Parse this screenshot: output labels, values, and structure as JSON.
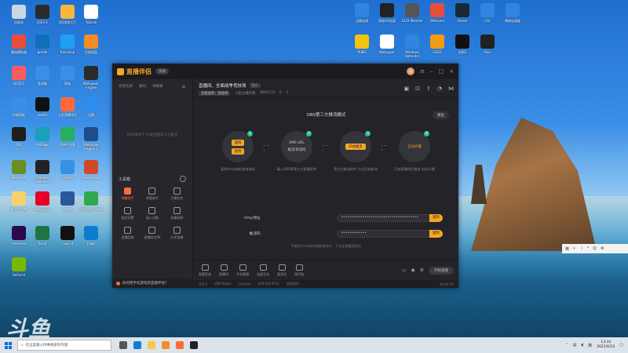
{
  "wallpaper_watermark": "斗鱼",
  "desktop_icons": [
    {
      "label": "回收站",
      "color": "#c9d6e3"
    },
    {
      "label": "2024-1",
      "color": "#2b2b2b"
    },
    {
      "label": "QQ游戏大厅",
      "color": "#f6b73c"
    },
    {
      "label": "ToDesk",
      "color": "#ffffff"
    },
    {
      "label": "雷电模拟器",
      "color": "#e74c3c"
    },
    {
      "label": "gradle",
      "color": "#0f6fb8"
    },
    {
      "label": "RainDrop",
      "color": "#1ea1f2"
    },
    {
      "label": "百度网盘",
      "color": "#f28c28"
    },
    {
      "label": "QQ音乐",
      "color": "#ff5a5f"
    },
    {
      "label": "此电脑",
      "color": "#3a8ee6"
    },
    {
      "label": "网络",
      "color": "#3a8ee6"
    },
    {
      "label": "Wallpaper Engine",
      "color": "#2a2a2a"
    },
    {
      "label": "控制面板",
      "color": "#3a8ee6"
    },
    {
      "label": "obs64",
      "color": "#111111"
    },
    {
      "label": "斗鱼直播伴侣",
      "color": "#ff6a3d"
    },
    {
      "label": "迅雷",
      "color": "#2d8cf0"
    },
    {
      "label": "QQ",
      "color": "#1e1e1e"
    },
    {
      "label": "ArtRage",
      "color": "#1aa0b8"
    },
    {
      "label": "剪映专业版",
      "color": "#27ae60"
    },
    {
      "label": "Wallpaper Engine 2",
      "color": "#1e4d8c"
    },
    {
      "label": "Minecraft",
      "color": "#6b8e23"
    },
    {
      "label": "Onboard Ultimate",
      "color": "#222222"
    },
    {
      "label": "QQ空间",
      "color": "#3a8ee6"
    },
    {
      "label": "PowerPoint",
      "color": "#d24726"
    },
    {
      "label": "新建文件夹",
      "color": "#f7d26a"
    },
    {
      "label": "网易云音乐",
      "color": "#e60026"
    },
    {
      "label": "Word",
      "color": "#2b579a"
    },
    {
      "label": "Microsoft Store",
      "color": "#2fa84f"
    },
    {
      "label": "Premiere",
      "color": "#2a0a4a"
    },
    {
      "label": "Excel",
      "color": "#217346"
    },
    {
      "label": "CapCut",
      "color": "#111111"
    },
    {
      "label": "Edge",
      "color": "#0f7ccf"
    },
    {
      "label": "GeForce",
      "color": "#76b900"
    }
  ],
  "right_icons": [
    {
      "label": "迅雷加速",
      "color": "#2e86de"
    },
    {
      "label": "网易UU加速",
      "color": "#222222"
    },
    {
      "label": "1020 Monster",
      "color": "#555555"
    },
    {
      "label": "WeGame",
      "color": "#e74c3c"
    },
    {
      "label": "Steam",
      "color": "#1b2838"
    },
    {
      "label": "LOL",
      "color": "#2e86de"
    },
    {
      "label": "雷神加速器",
      "color": "#2e86de"
    },
    {
      "label": "PUBG",
      "color": "#f1c40f"
    },
    {
      "label": "Wallpaper",
      "color": "#ffffff"
    },
    {
      "label": "Windows Defender",
      "color": "#2e86de"
    },
    {
      "label": "CSGO",
      "color": "#f39c12"
    },
    {
      "label": "剑网3",
      "color": "#111111"
    },
    {
      "label": "Pixiv",
      "color": "#222222"
    }
  ],
  "app": {
    "logo_text": "直播伴侣",
    "version_badge": "旗舰",
    "left_tabs": [
      "场景选择",
      "素材",
      "弹幕箱"
    ],
    "left_empty_text": "OBS模式下 仅能直播第三方推流",
    "tools_heading": "工具箱",
    "tools": [
      {
        "label": "弹幕助手",
        "icon": "danmaku-icon",
        "active": true
      },
      {
        "label": "房管助手",
        "icon": "user-icon",
        "active": false
      },
      {
        "label": "主播任务",
        "icon": "task-icon",
        "active": false
      },
      {
        "label": "抽奖设置",
        "icon": "gift-icon",
        "active": false
      },
      {
        "label": "录入设备",
        "icon": "record-icon",
        "active": false
      },
      {
        "label": "屏幕录制",
        "icon": "screen-icon",
        "active": false
      },
      {
        "label": "直播回放",
        "icon": "replay-icon",
        "active": false
      },
      {
        "label": "直播排名PK",
        "icon": "pk-icon",
        "active": false
      },
      {
        "label": "分享直播",
        "icon": "share-icon",
        "active": false
      }
    ],
    "left_footer": "如何把手机游戏到直播伴侣？",
    "room_title": "直播间、全面战争竞技场",
    "room_tag": "官方",
    "room_meta": {
      "category": "全面战争：竞技场",
      "anchor": "斗鱼主播开播",
      "room_id": "8983176",
      "fans": "0",
      "viewers": "1"
    },
    "mode_title": "OBS第三方推流模式",
    "exit_label": "退出",
    "steps": [
      {
        "number": "1",
        "items": [
          "复制",
          "复制"
        ],
        "desc": "复制rtmp地址和推流码",
        "highlight": false
      },
      {
        "number": "2",
        "items": [
          "RMS URL",
          "推流/串流码"
        ],
        "desc": "填入OBS等第三方直播软件",
        "highlight": false
      },
      {
        "number": "3",
        "items": [
          "开始推流"
        ],
        "desc": "第三方推流软件 点击开始推流",
        "highlight": true
      },
      {
        "number": "4",
        "items": [
          "自动开播"
        ],
        "desc": "开启直播伴侣推流 自动开播",
        "highlight": false
      }
    ],
    "rtmp_label": "rtmp地址",
    "rtmp_value": "•••••••••••••••••••••••••••••••••••••",
    "key_label": "推流码",
    "key_value": "••••••••••••",
    "copy_label": "复制",
    "hint": "不能在rtmp地址和推流码中，下方无需截屏保存",
    "toolbar": [
      "直播音效",
      "直播间",
      "手机直播",
      "连麦互动",
      "麦克风",
      "扬声器"
    ],
    "start_live_label": "开始直播",
    "status": {
      "fps": "FPS:0",
      "bitrate": "码率:0kbps",
      "cpu": "CPU:0%",
      "drop": "丢帧:0(0.00%)",
      "net": "网络良好",
      "duration": "00:00:00"
    }
  },
  "ime": {
    "items": [
      "英",
      "•",
      "☽",
      "°",
      "☺",
      "⚙"
    ]
  },
  "taskbar": {
    "search_placeholder": "在这里输入你要搜索的内容",
    "time": "13:34",
    "date": "2021/6/10",
    "lang": "英"
  }
}
